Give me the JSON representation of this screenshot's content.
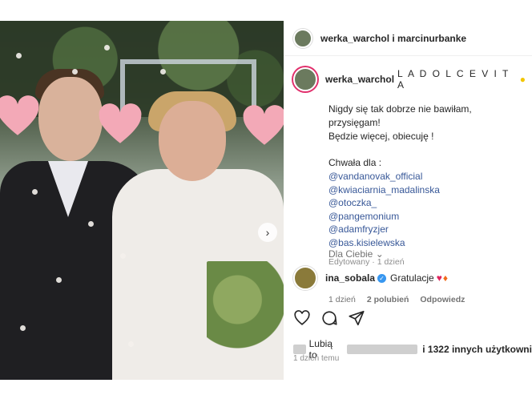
{
  "header": {
    "title": "werka_warchol i marcinurbanke"
  },
  "caption": {
    "username": "werka_warchol",
    "tag": "L A D O L C E V I T A",
    "lines": [
      "Nigdy się tak dobrze nie bawiłam, przysięgam!",
      "Będzie więcej, obiecuję !"
    ],
    "credits_title": "Chwała dla :",
    "credits": [
      "@vandanovak_official",
      "@kwiaciarnia_madalinska",
      "@otoczka_",
      "@pangemonium",
      "@adamfryzjer",
      "@bas.kisielewska"
    ],
    "meta": "Edytowany · 1 dzień"
  },
  "section_label": "Dla Ciebie ⌄",
  "comment": {
    "username": "ina_sobala",
    "text": "Gratulacje",
    "time": "1 dzień",
    "likes": "2 polubień",
    "reply": "Odpowiedz"
  },
  "likes_line": {
    "prefix": "Lubią to",
    "suffix": "i 1322 innych użytkowni"
  },
  "post_time": "1 dzień temu",
  "icons": [
    "heart-outline-icon",
    "comment-icon",
    "share-icon",
    "verified-icon",
    "chevron-right-icon"
  ],
  "colors": {
    "link": "#385898",
    "muted": "#737373",
    "heart_overlay": "#f3a9b7",
    "verified": "#3897f0"
  }
}
